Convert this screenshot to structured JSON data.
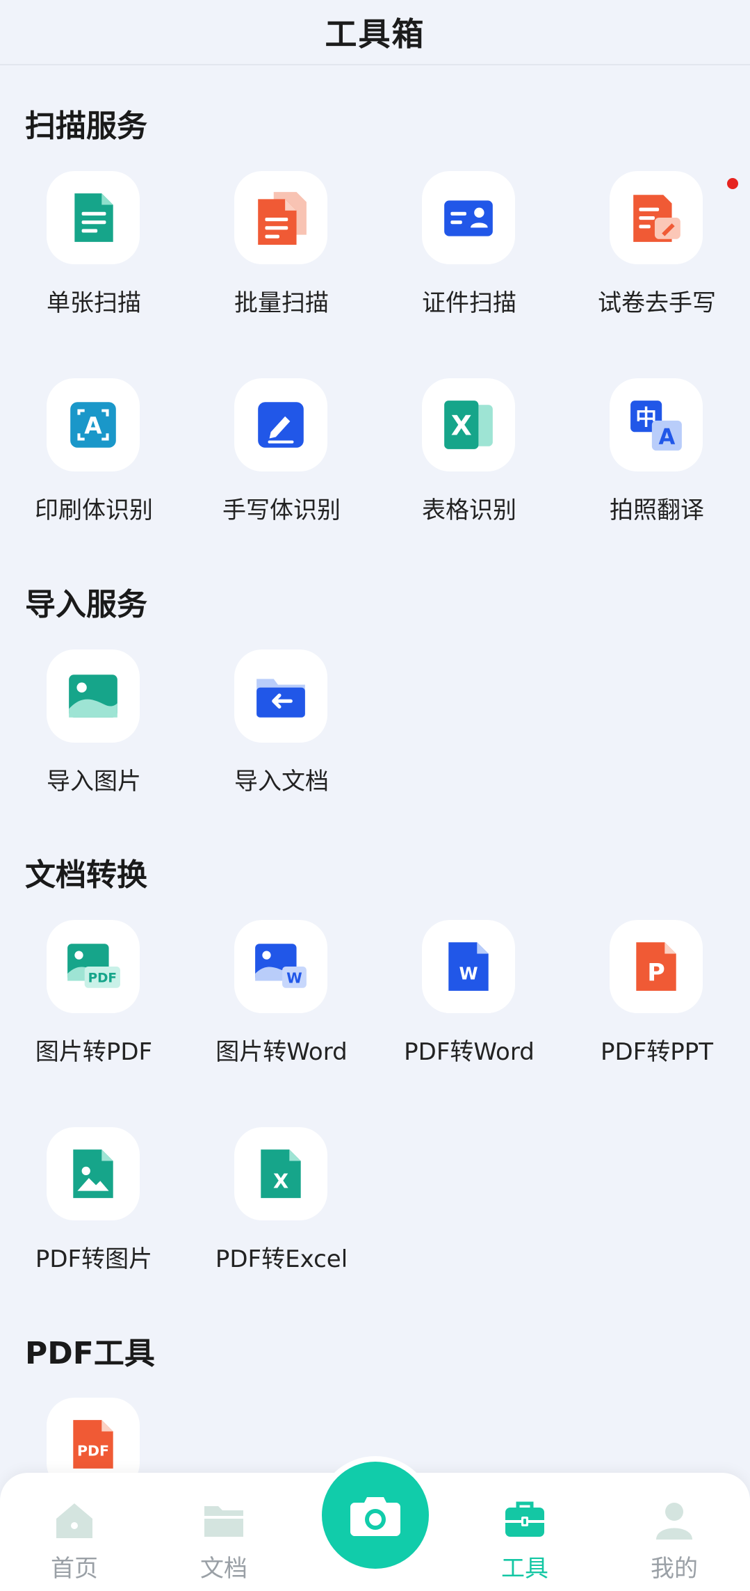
{
  "header": {
    "title": "工具箱"
  },
  "sections": {
    "scan": {
      "title": "扫描服务",
      "items": [
        "单张扫描",
        "批量扫描",
        "证件扫描",
        "试卷去手写",
        "印刷体识别",
        "手写体识别",
        "表格识别",
        "拍照翻译"
      ]
    },
    "import": {
      "title": "导入服务",
      "items": [
        "导入图片",
        "导入文档"
      ]
    },
    "convert": {
      "title": "文档转换",
      "items": [
        "图片转PDF",
        "图片转Word",
        "PDF转Word",
        "PDF转PPT",
        "PDF转图片",
        "PDF转Excel"
      ]
    },
    "pdf": {
      "title": "PDF工具",
      "items": [
        ""
      ]
    }
  },
  "icons": {
    "scan": [
      "document-icon",
      "batch-document-icon",
      "id-card-icon",
      "erase-handwriting-icon",
      "ocr-print-icon",
      "handwriting-pen-icon",
      "excel-table-icon",
      "translate-icon"
    ],
    "import": [
      "image-icon",
      "folder-import-icon"
    ],
    "convert": [
      "image-to-pdf-icon",
      "image-to-word-icon",
      "word-icon",
      "ppt-icon",
      "pdf-to-image-icon",
      "pdf-to-excel-icon"
    ],
    "pdf": [
      "pdf-icon"
    ]
  },
  "icon_text": {
    "translate_cn": "中",
    "translate_en": "A",
    "ocr": "A",
    "excel": "X",
    "pdf": "PDF",
    "word": "W",
    "ppt": "P"
  },
  "nav": {
    "home": "首页",
    "docs": "文档",
    "tools": "工具",
    "mine": "我的"
  },
  "colors": {
    "accent": "#14c7a4",
    "green": "#16a58a",
    "red_orange": "#f05a35",
    "blue": "#2157e8",
    "background": "#f0f3fa"
  }
}
